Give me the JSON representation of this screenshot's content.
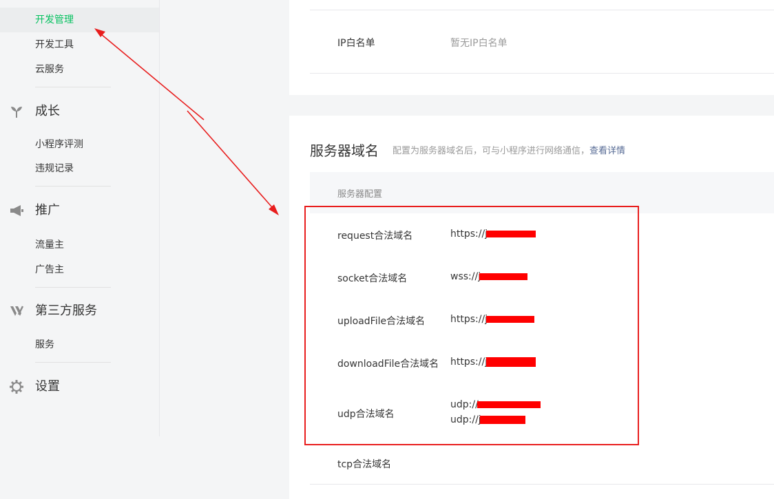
{
  "sidebar": {
    "dev_items": [
      {
        "label": "开发管理",
        "active": true
      },
      {
        "label": "开发工具",
        "active": false
      },
      {
        "label": "云服务",
        "active": false
      }
    ],
    "groups": [
      {
        "icon": "sprout-icon",
        "label": "成长",
        "items": [
          "小程序评测",
          "违规记录"
        ]
      },
      {
        "icon": "megaphone-icon",
        "label": "推广",
        "items": [
          "流量主",
          "广告主"
        ]
      },
      {
        "icon": "third-party-icon",
        "label": "第三方服务",
        "items": [
          "服务"
        ]
      },
      {
        "icon": "gear-icon",
        "label": "设置",
        "items": []
      }
    ]
  },
  "ip_whitelist": {
    "label": "IP白名单",
    "value": "暂无IP白名单"
  },
  "server_domain": {
    "title": "服务器域名",
    "description": "配置为服务器域名后，可与小程序进行网络通信，",
    "link": "查看详情",
    "table_header": "服务器配置",
    "rows": [
      {
        "label": "request合法域名",
        "values": [
          "https://j"
        ]
      },
      {
        "label": "socket合法域名",
        "values": [
          "wss://j"
        ]
      },
      {
        "label": "uploadFile合法域名",
        "values": [
          "https://j"
        ]
      },
      {
        "label": "downloadFile合法域名",
        "values": [
          "https://j"
        ]
      },
      {
        "label": "udp合法域名",
        "values": [
          "udp://",
          "udp://j"
        ]
      },
      {
        "label": "tcp合法域名",
        "values": []
      }
    ]
  },
  "colors": {
    "accent": "#07c160",
    "annotation": "#e81d1d",
    "link": "#576b95"
  }
}
